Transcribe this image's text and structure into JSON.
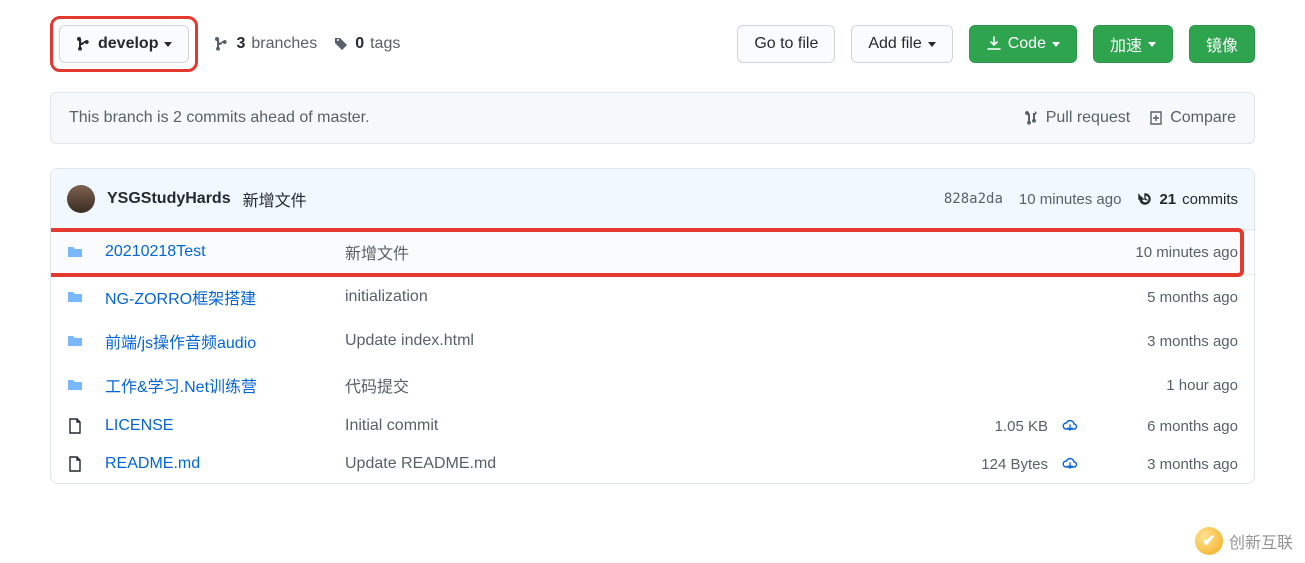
{
  "toolbar": {
    "branch_label": "develop",
    "branches_count": "3",
    "branches_word": "branches",
    "tags_count": "0",
    "tags_word": "tags",
    "go_to_file": "Go to file",
    "add_file": "Add file",
    "code": "Code",
    "accelerate": "加速",
    "mirror": "镜像"
  },
  "branch_bar": {
    "text": "This branch is 2 commits ahead of master.",
    "pull_request": "Pull request",
    "compare": "Compare"
  },
  "commit_header": {
    "author": "YSGStudyHards",
    "message": "新增文件",
    "sha": "828a2da",
    "time": "10 minutes ago",
    "commits_count": "21",
    "commits_word": "commits"
  },
  "files": [
    {
      "type": "dir",
      "name": "20210218Test",
      "msg": "新增文件",
      "size": "",
      "time": "10 minutes ago",
      "dl": false,
      "hl": true
    },
    {
      "type": "dir",
      "name": "NG-ZORRO框架搭建",
      "msg": "initialization",
      "size": "",
      "time": "5 months ago",
      "dl": false
    },
    {
      "type": "dir",
      "name": "前端/js操作音频audio",
      "msg": "Update index.html",
      "size": "",
      "time": "3 months ago",
      "dl": false
    },
    {
      "type": "dir",
      "name": "工作&学习.Net训练营",
      "msg": "代码提交",
      "size": "",
      "time": "1 hour ago",
      "dl": false
    },
    {
      "type": "file",
      "name": "LICENSE",
      "msg": "Initial commit",
      "size": "1.05 KB",
      "time": "6 months ago",
      "dl": true
    },
    {
      "type": "file",
      "name": "README.md",
      "msg": "Update README.md",
      "size": "124 Bytes",
      "time": "3 months ago",
      "dl": true
    }
  ],
  "watermark": {
    "text": "创新互联"
  }
}
